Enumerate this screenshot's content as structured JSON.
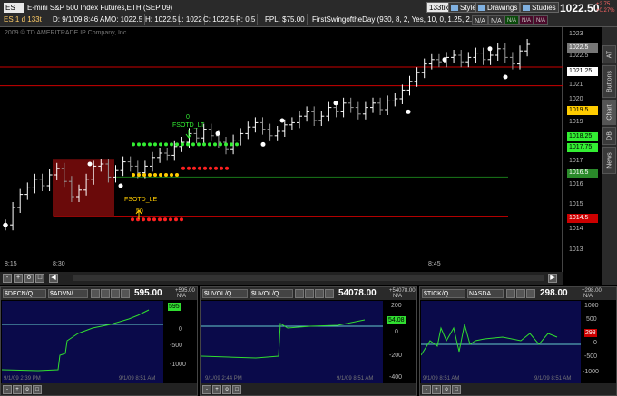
{
  "toolbar": {
    "symbol": "ES",
    "description": "E-mini S&P 500 Index Futures,ETH (SEP 09)",
    "quote_size": "133tik",
    "style_label": "Style",
    "drawings_label": "Drawings",
    "studies_label": "Studies",
    "last_price": "1022.50",
    "change": "+2.75",
    "change_pct": "+0.27%"
  },
  "chart_header": {
    "chart_id": "ES 1 d 133t",
    "datetime": "D: 9/1/09 8:46 AM",
    "open": "O: 1022.5",
    "high": "H: 1022.5",
    "low": "L: 1022",
    "close": "C: 1022.5",
    "range": "R: 0.5",
    "fpl": "FPL: $75.00",
    "study": "FirstSwingoftheDay (930, 8, 2, Yes, 10, 0, 1.25, 2.0)",
    "na1": "N/A",
    "na2": "N/A",
    "nab1": "N/A",
    "nab2": "N/A",
    "nab3": "N/A"
  },
  "copyright": "2009 © TD AMERITRADE IP Company, Inc.",
  "y_ticks": [
    "1023",
    "1022.5",
    "1021.25",
    "1021",
    "1020",
    "1019.5",
    "1019",
    "1018.25",
    "1017.75",
    "1017",
    "1016.5",
    "1016",
    "1015",
    "1014.5",
    "1014",
    "1013"
  ],
  "price_tags": {
    "t1": "1022.5",
    "t2": "1021.25",
    "t3": "1019.5",
    "t4": "1018.25",
    "t5": "1017.75",
    "t6": "1016.5",
    "t7": "1014.5"
  },
  "side_tabs": [
    "AT",
    "Buttons",
    "Chart",
    "DB",
    "News"
  ],
  "x_ticks": [
    "8:15",
    "8:30",
    "8:45"
  ],
  "annotations": {
    "short_label": "FSOTD_LT",
    "short_qty": "0",
    "long_label": "FSOTD_LE",
    "long_qty": "50"
  },
  "colors": {
    "up_bar": "#ffffff",
    "down_bar": "#9a9a9a",
    "stop_line": "#cc0000",
    "long_dots": "#ffcc00",
    "target_dots": "#33ee33",
    "stop_dots": "#ff2020",
    "entry_zone": "#6a0a0a",
    "panel_bg": "#0a0a4a",
    "panel_line": "#30dd30",
    "panel_ref": "#66cccc"
  },
  "panels": [
    {
      "sym1": "$DECN/Q",
      "sym2": "$ADVN/...",
      "value": "595.00",
      "na": "N/A",
      "ref": "+595.00",
      "tag": "595",
      "axis": [
        "0",
        "-500",
        "-1000"
      ],
      "date1": "9/1/09 2:39 PM",
      "date2": "9/1/09 8:51 AM"
    },
    {
      "sym1": "$UVOL/Q",
      "sym2": "$UVOL/Q...",
      "value": "54078.00",
      "na": "N/A",
      "ref": "+54078.00",
      "tag": "54.08",
      "axis": [
        "200",
        "0",
        "-200",
        "-400"
      ],
      "date1": "9/1/09 2:44 PM",
      "date2": "9/1/09 8:51 AM"
    },
    {
      "sym1": "$TICK/Q",
      "sym2": "NASDA...",
      "value": "298.00",
      "na": "N/A",
      "ref": "+298.00",
      "tag": "298",
      "axis": [
        "1000",
        "500",
        "0",
        "-500",
        "-1000"
      ],
      "date1": "9/1/09 8:51 AM",
      "date2": "9/1/09 8:51 AM"
    }
  ]
}
